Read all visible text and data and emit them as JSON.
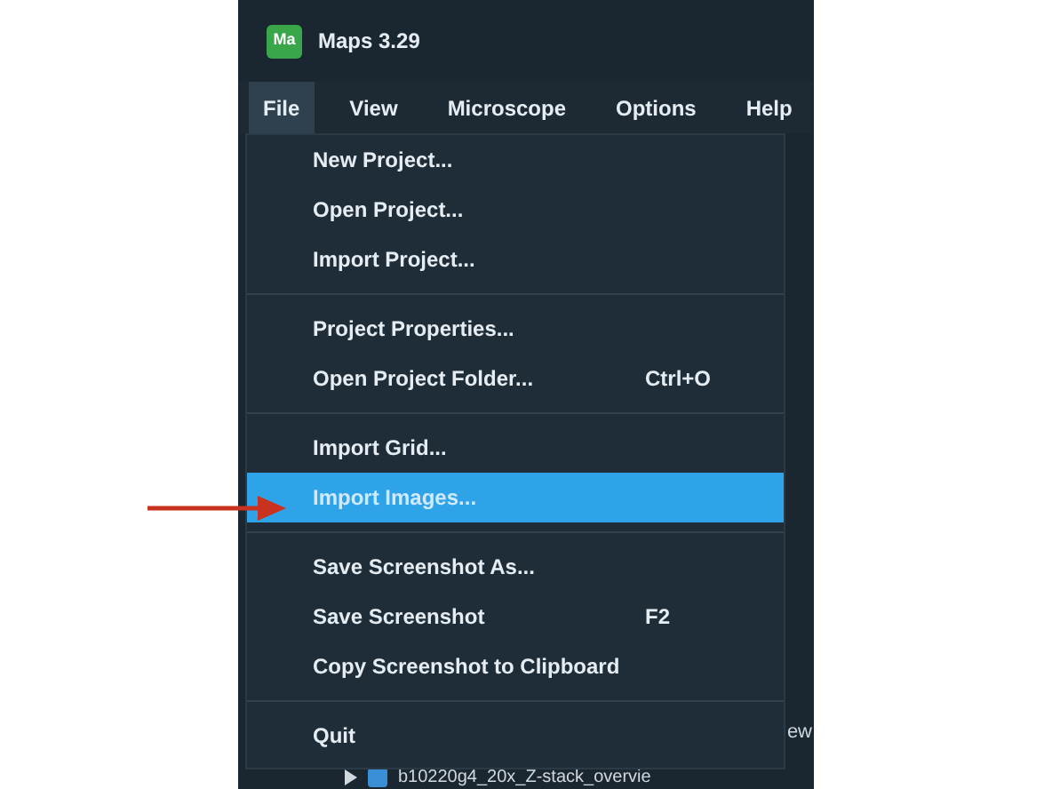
{
  "window": {
    "title": "Maps 3.29",
    "app_icon": "Ma"
  },
  "menubar": [
    {
      "label": "File",
      "selected": true
    },
    {
      "label": "View",
      "selected": false
    },
    {
      "label": "Microscope",
      "selected": false
    },
    {
      "label": "Options",
      "selected": false
    },
    {
      "label": "Help",
      "selected": false
    }
  ],
  "menu": {
    "items": [
      {
        "kind": "item",
        "label": "New Project...",
        "selected": false
      },
      {
        "kind": "item",
        "label": "Open Project...",
        "selected": false
      },
      {
        "kind": "item",
        "label": "Import Project...",
        "selected": false
      },
      {
        "kind": "separator"
      },
      {
        "kind": "item",
        "label": "Project Properties...",
        "selected": false
      },
      {
        "kind": "item",
        "label": "Open Project Folder...",
        "shortcut": "Ctrl+O",
        "selected": false
      },
      {
        "kind": "separator"
      },
      {
        "kind": "item",
        "label": "Import Grid...",
        "selected": false
      },
      {
        "kind": "item",
        "label": "Import Images...",
        "selected": true
      },
      {
        "kind": "separator"
      },
      {
        "kind": "item",
        "label": "Save Screenshot As...",
        "selected": false
      },
      {
        "kind": "item",
        "label": "Save Screenshot",
        "shortcut": "F2",
        "selected": false
      },
      {
        "kind": "item",
        "label": "Copy Screenshot to Clipboard",
        "selected": false
      },
      {
        "kind": "separator"
      },
      {
        "kind": "item",
        "label": "Quit",
        "selected": false
      }
    ]
  },
  "background": {
    "cut_text": "ew",
    "tree_row": {
      "label": "b10220g4_20x_Z-stack_overvie",
      "checked": true
    }
  }
}
